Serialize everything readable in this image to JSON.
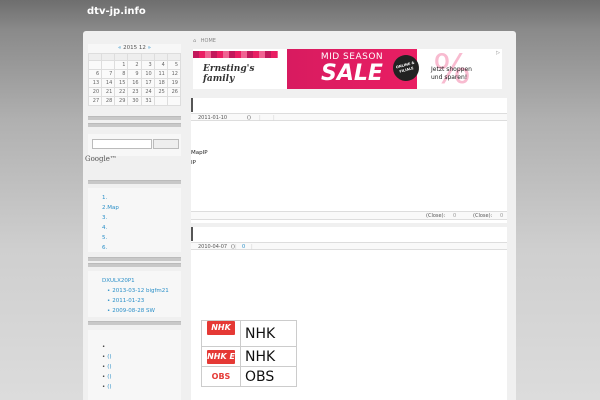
{
  "site": {
    "title": "dtv-jp.info"
  },
  "calendar": {
    "prev_label": "«",
    "year": "2015",
    "month": "12",
    "next_label": "»",
    "weeks": [
      [
        "",
        "",
        "1",
        "2",
        "3",
        "4",
        "5"
      ],
      [
        "6",
        "7",
        "8",
        "9",
        "10",
        "11",
        "12"
      ],
      [
        "13",
        "14",
        "15",
        "16",
        "17",
        "18",
        "19"
      ],
      [
        "20",
        "21",
        "22",
        "23",
        "24",
        "25",
        "26"
      ],
      [
        "27",
        "28",
        "29",
        "30",
        "31",
        "",
        ""
      ]
    ]
  },
  "search": {
    "google_label": "Google™"
  },
  "menu_widget": {
    "items": [
      "1.",
      "2.Map",
      "3.",
      "4.",
      "5.",
      "6."
    ]
  },
  "archive_widget": {
    "parent": "DXULX20P1",
    "children": [
      "2013-03-12 bigfm21",
      "2011-01-23",
      "2009-08-28 SW"
    ]
  },
  "bottom_widget": {
    "items": [
      "",
      "()",
      "()",
      "()",
      "()"
    ]
  },
  "breadcrumb": {
    "home_icon": "home-icon",
    "label": "HOME"
  },
  "ad": {
    "brand": "Ernsting's family",
    "headline": "MID SEASON",
    "sale": "SALE",
    "badge": "ONLINE & FILIALE",
    "percent": "%",
    "cta_line1": "Jetzt shoppen",
    "cta_line2": "und sparen!",
    "info": "▷"
  },
  "post1": {
    "date": "2011-01-10",
    "comments": "()",
    "body_line1": "MapIP",
    "body_line2": "IP",
    "footer_left": "(Close):",
    "footer_left_val": "0",
    "footer_right": "(Close):",
    "footer_right_val": "0"
  },
  "post2": {
    "date": "2010-04-07",
    "comments": "()",
    "extra": "0"
  },
  "channels": [
    {
      "logo": "NHK G",
      "name": "NHK"
    },
    {
      "logo": "NHK E",
      "name": "NHK"
    },
    {
      "logo": "OBS",
      "name": "OBS"
    }
  ]
}
